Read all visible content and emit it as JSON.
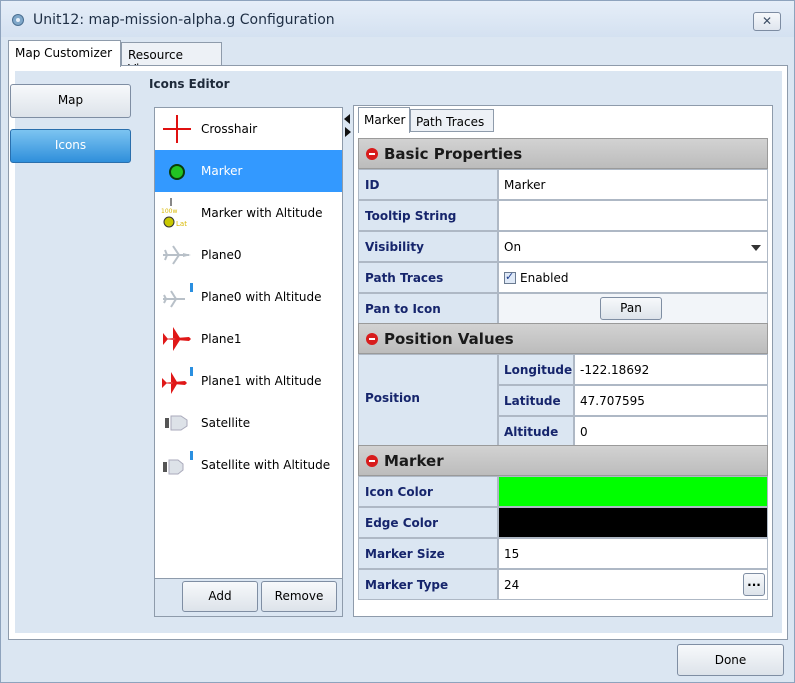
{
  "window": {
    "title": "Unit12: map-mission-alpha.g Configuration",
    "close_glyph": "✕"
  },
  "top_tabs": [
    {
      "label": "Map Customizer",
      "active": true
    },
    {
      "label": "Resource View",
      "active": false
    }
  ],
  "nav": {
    "map_label": "Map",
    "icons_label": "Icons"
  },
  "icons_editor": {
    "title": "Icons Editor",
    "items": [
      {
        "label": "Crosshair",
        "icon": "crosshair-icon"
      },
      {
        "label": "Marker",
        "icon": "marker-icon",
        "selected": true
      },
      {
        "label": "Marker with Altitude",
        "icon": "marker-altitude-icon"
      },
      {
        "label": "Plane0",
        "icon": "plane0-icon"
      },
      {
        "label": "Plane0 with Altitude",
        "icon": "plane0-altitude-icon"
      },
      {
        "label": "Plane1",
        "icon": "plane1-icon"
      },
      {
        "label": "Plane1 with Altitude",
        "icon": "plane1-altitude-icon"
      },
      {
        "label": "Satellite",
        "icon": "satellite-icon"
      },
      {
        "label": "Satellite with Altitude",
        "icon": "satellite-altitude-icon"
      }
    ],
    "add_label": "Add",
    "remove_label": "Remove"
  },
  "sub_tabs": [
    {
      "label": "Marker",
      "active": true
    },
    {
      "label": "Path Traces",
      "active": false
    }
  ],
  "properties": {
    "basic": {
      "header": "Basic Properties",
      "id_label": "ID",
      "id_value": "Marker",
      "tooltip_label": "Tooltip String",
      "tooltip_value": "",
      "visibility_label": "Visibility",
      "visibility_value": "On",
      "path_traces_label": "Path Traces",
      "path_traces_value": "Enabled",
      "pan_label": "Pan to Icon",
      "pan_button": "Pan"
    },
    "position": {
      "header": "Position Values",
      "label": "Position",
      "longitude_label": "Longitude",
      "longitude_value": "-122.18692",
      "latitude_label": "Latitude",
      "latitude_value": "47.707595",
      "altitude_label": "Altitude",
      "altitude_value": "0"
    },
    "marker": {
      "header": "Marker",
      "icon_color_label": "Icon Color",
      "icon_color": "#00ff00",
      "edge_color_label": "Edge Color",
      "edge_color": "#000000",
      "size_label": "Marker Size",
      "size_value": "15",
      "type_label": "Marker Type",
      "type_value": "24",
      "ellipsis": "..."
    }
  },
  "done_label": "Done",
  "colors": {
    "selected": "#3399ff",
    "label_text": "#16256c",
    "panel_bg": "#dbe6f2"
  },
  "altitude_glyph": "100w\nLat"
}
